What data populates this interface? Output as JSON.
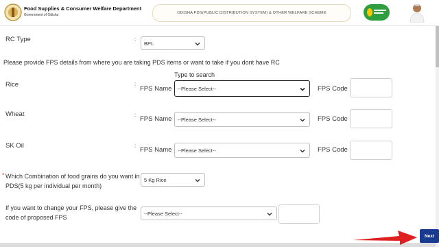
{
  "header": {
    "dept_title": "Food Supplies & Consumer Welfare Department",
    "dept_subtitle": "Government of Odisha",
    "banner_text": "ODISHA PDS(PUBLIC DISTRIBUTION SYSTEM) & OTHER WELFARE SCHEME",
    "logo_name": "food-supplies-logo",
    "photo_name": "cm-portrait"
  },
  "rc_type": {
    "label": "RC Type",
    "value": "BPL"
  },
  "instruction": "Please provide FPS details from where you are taking PDS items or want to take if you dont have RC",
  "type_to_search": "Type to search",
  "rows": [
    {
      "label": "Rice",
      "fps_name_label": "FPS Name :",
      "fps_value": "--Please Select--",
      "fps_code_label": "FPS Code :"
    },
    {
      "label": "Wheat",
      "fps_name_label": "FPS Name :",
      "fps_value": "--Please Select--",
      "fps_code_label": "FPS Code :"
    },
    {
      "label": "SK Oil",
      "fps_name_label": "FPS Name :",
      "fps_value": "--Please Select--",
      "fps_code_label": "FPS Code :"
    }
  ],
  "combination": {
    "required_mark": "*",
    "label_line1": "Which Combination of food grains do you want in",
    "label_line2": "PDS(5 kg per individual per month)",
    "value": "5 Kg Rice"
  },
  "change_fps": {
    "label_line1": "If you want to change your FPS, please give the",
    "label_line2": "code of proposed FPS",
    "value": "--Please Select--"
  },
  "colon": ":",
  "next_label": "Next",
  "colors": {
    "next_button": "#1a3a8f",
    "annotation_arrow": "#e02020",
    "logo_green": "#2e9e3e"
  }
}
